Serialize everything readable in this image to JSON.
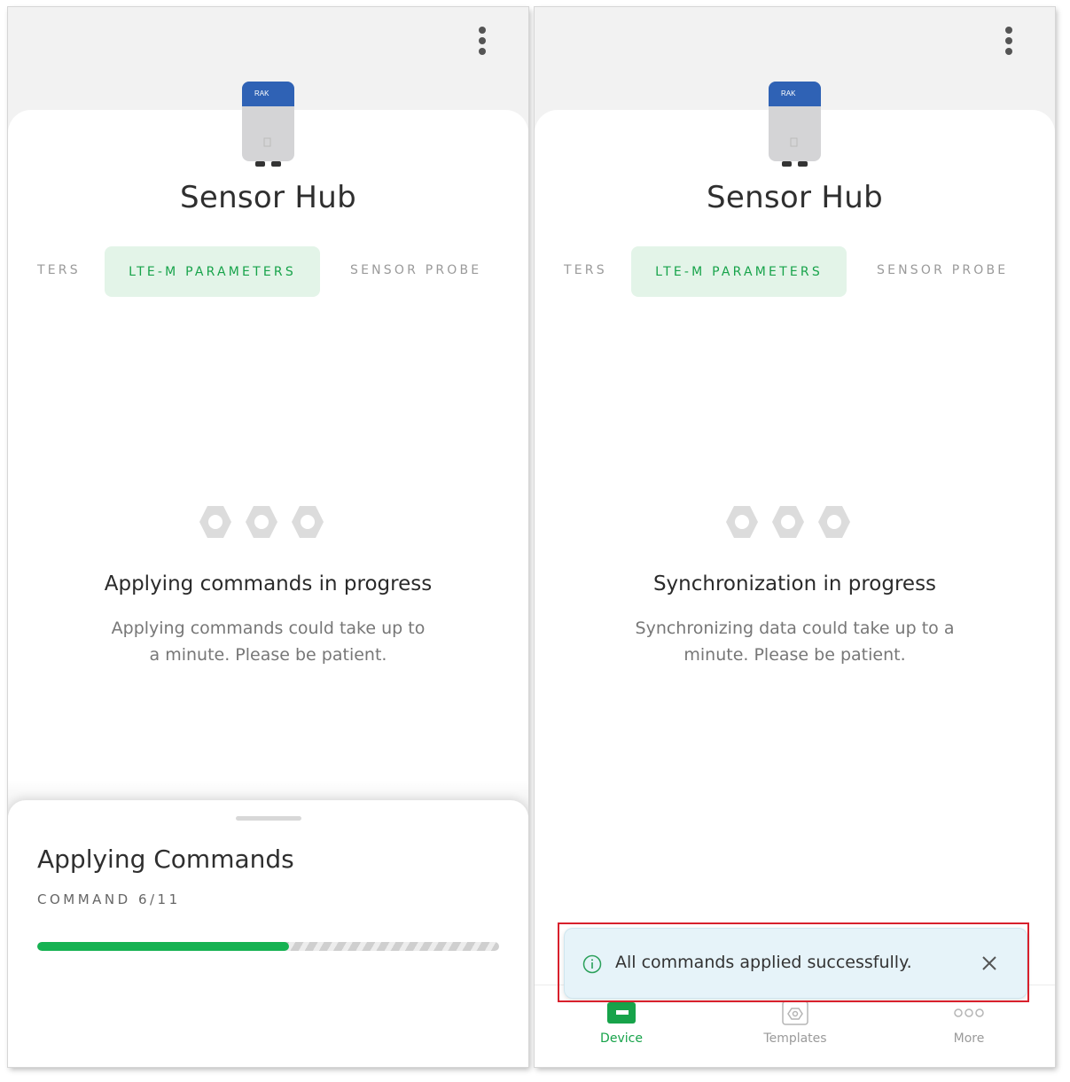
{
  "left": {
    "device_name": "Sensor Hub",
    "device_brand": "RAK",
    "tabs": [
      "TERS",
      "LTE-M PARAMETERS",
      "SENSOR PROBE"
    ],
    "active_tab": "LTE-M PARAMETERS",
    "status_title": "Applying commands in progress",
    "status_desc": "Applying commands could take up to a minute. Please be patient.",
    "sheet": {
      "title": "Applying Commands",
      "subtitle": "COMMAND 6/11",
      "progress_fraction": 0.545
    }
  },
  "right": {
    "device_name": "Sensor Hub",
    "device_brand": "RAK",
    "tabs": [
      "TERS",
      "LTE-M PARAMETERS",
      "SENSOR PROBE"
    ],
    "active_tab": "LTE-M PARAMETERS",
    "status_title": "Synchronization in progress",
    "status_desc": "Synchronizing data could take up to a minute. Please be patient.",
    "toast": {
      "icon": "info-icon",
      "message": "All commands applied successfully."
    },
    "nav": [
      {
        "label": "Device",
        "icon": "device-icon",
        "active": true
      },
      {
        "label": "Templates",
        "icon": "template-icon",
        "active": false
      },
      {
        "label": "More",
        "icon": "more-dots-icon",
        "active": false
      }
    ]
  },
  "colors": {
    "accent_green": "#17a34a",
    "tab_active_bg": "#e3f4e8",
    "toast_bg": "#e6f3f9",
    "highlight_red": "#d8202c"
  }
}
